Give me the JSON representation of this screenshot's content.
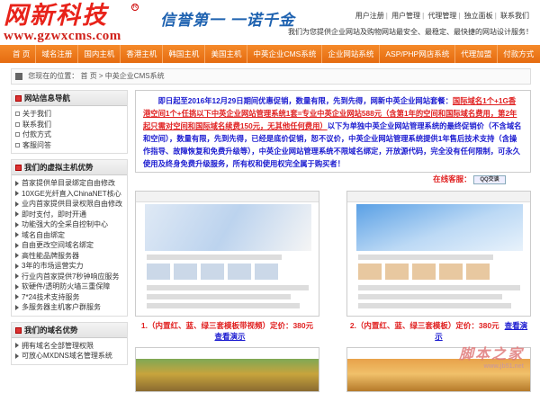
{
  "header": {
    "logo_cn": "网新科技",
    "logo_url": "www.gzwxcms.com",
    "slogan": "信誉第一 一诺千金",
    "top_links": [
      "用户注册",
      "用户管理",
      "代理管理",
      "独立面板",
      "联系我们"
    ],
    "tagline": "我们为您提供企业网站及购物网站最安全、最稳定、最快捷的网站设计服务！"
  },
  "nav": {
    "items": [
      "首 页",
      "域名注册",
      "国内主机",
      "香港主机",
      "韩国主机",
      "美国主机",
      "中英企业CMS系统",
      "企业网站系统",
      "ASP/PHP网店系统",
      "代理加盟",
      "付款方式"
    ]
  },
  "breadcrumb": {
    "prefix": "您现在的位置：",
    "path": "首 页 > 中英企业CMS系统"
  },
  "sidebar": {
    "nav_title": "网站信息导航",
    "nav_items": [
      "关于我们",
      "联系我们",
      "付款方式",
      "客服问答"
    ],
    "hosting_title": "我们的虚拟主机优势",
    "hosting_items": [
      "首家提供单目录绑定自由修改",
      "10XGE光纤直入ChinaNET核心",
      "业内首家提供目录权限自由修改",
      "即时支付，即时开通",
      "功能强大的全采自控制中心",
      "域名自由绑定",
      "自由更改空间域名绑定",
      "高性能品牌服务器",
      "3年的市场运营实力",
      "行业内首家提供7秒钟响应服务",
      "软硬件/透明防火墙三重保障",
      "7*24技术支持服务",
      "多服务器主机客户群服务"
    ],
    "domain_title": "我们的域名优势",
    "domain_items": [
      "拥有域名全部管理权限",
      "可放心MXDNS域名管理系统"
    ]
  },
  "main": {
    "promo_1": "即日起至2016年12月29日期间优惠促销，数量有限，先到先得，网新中英企业网站套餐：",
    "promo_red_1": "国际域名1个+1G香港空间1个+任挑以下中英企业网站管理系统1套=专业中英企业网站588元（含第1年的空间和国际域名费用，第2年起只需对空间和国际域名续费150元，无其他任何费用）",
    "promo_2": "以下为单独中英企业网站管理系统的最终促销价（不含域名和空间），数量有限，先到先得，已经是底价促销，恕不议价，中英企业网站管理系统提供1年售后技术支持（含操作指导、故障恢复和免费升级等），中英企业网站管理系统不限域名绑定，开放源代码，完全没有任何限制，可永久使用及终身免费升级服务，所有权和使用权完全属于购买者！",
    "contact_label": "在线客服：",
    "qq_label": "QQ交谈",
    "products": [
      {
        "caption": "1.（内置红、蓝、绿三套模板带视频）定价：380元",
        "demo": "查看演示"
      },
      {
        "caption": "2.（内置红、蓝、绿三套模板）定价：380元",
        "demo": "查看演示"
      }
    ]
  },
  "watermark": {
    "text": "脚本之家",
    "sub": "www.jb51.net"
  },
  "colors": {
    "nav": "#e8741a",
    "logo_red": "#e8231a",
    "promo_blue": "#1a1ad0",
    "promo_red": "#e02020"
  }
}
